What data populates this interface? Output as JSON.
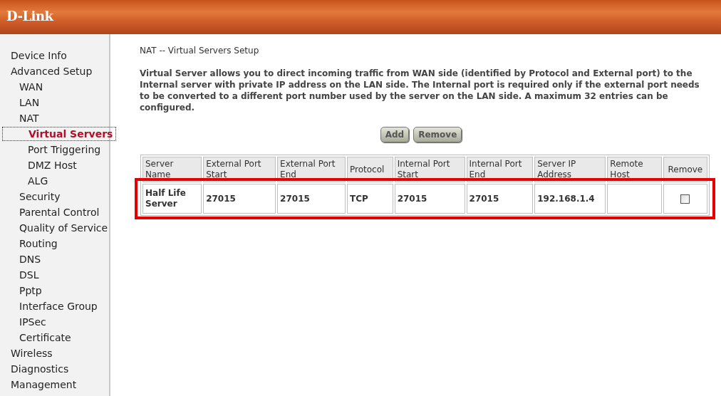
{
  "header": {
    "logo": "D-Link"
  },
  "sidebar": {
    "items": [
      {
        "label": "Device Info",
        "selected": false
      },
      {
        "label": "Advanced Setup",
        "selected": false,
        "children": [
          {
            "label": "WAN",
            "selected": false
          },
          {
            "label": "LAN",
            "selected": false
          },
          {
            "label": "NAT",
            "selected": false,
            "children": [
              {
                "label": "Virtual Servers",
                "selected": true
              },
              {
                "label": "Port Triggering",
                "selected": false
              },
              {
                "label": "DMZ Host",
                "selected": false
              },
              {
                "label": "ALG",
                "selected": false
              }
            ]
          },
          {
            "label": "Security",
            "selected": false
          },
          {
            "label": "Parental Control",
            "selected": false
          },
          {
            "label": "Quality of Service",
            "selected": false
          },
          {
            "label": "Routing",
            "selected": false
          },
          {
            "label": "DNS",
            "selected": false
          },
          {
            "label": "DSL",
            "selected": false
          },
          {
            "label": "Pptp",
            "selected": false
          },
          {
            "label": "Interface Group",
            "selected": false
          },
          {
            "label": "IPSec",
            "selected": false
          },
          {
            "label": "Certificate",
            "selected": false
          }
        ]
      },
      {
        "label": "Wireless",
        "selected": false
      },
      {
        "label": "Diagnostics",
        "selected": false
      },
      {
        "label": "Management",
        "selected": false
      }
    ]
  },
  "main": {
    "title": "NAT -- Virtual Servers Setup",
    "description": "Virtual Server allows you to direct incoming traffic from WAN side (identified by Protocol and External port) to the Internal server with private IP address on the LAN side. The Internal port is required only if the external port needs to be converted to a different port number used by the server on the LAN side. A maximum 32 entries can be configured.",
    "buttons": [
      "Add",
      "Remove"
    ],
    "table": {
      "columns": [
        "Server Name",
        "External Port Start",
        "External Port End",
        "Protocol",
        "Internal Port Start",
        "Internal Port End",
        "Server IP Address",
        "Remote Host",
        "Remove"
      ],
      "rows": [
        {
          "cells": [
            "Half Life Server",
            "27015",
            "27015",
            "TCP",
            "27015",
            "27015",
            "192.168.1.4",
            ""
          ],
          "remove_checked": false,
          "highlighted": true
        }
      ]
    }
  }
}
